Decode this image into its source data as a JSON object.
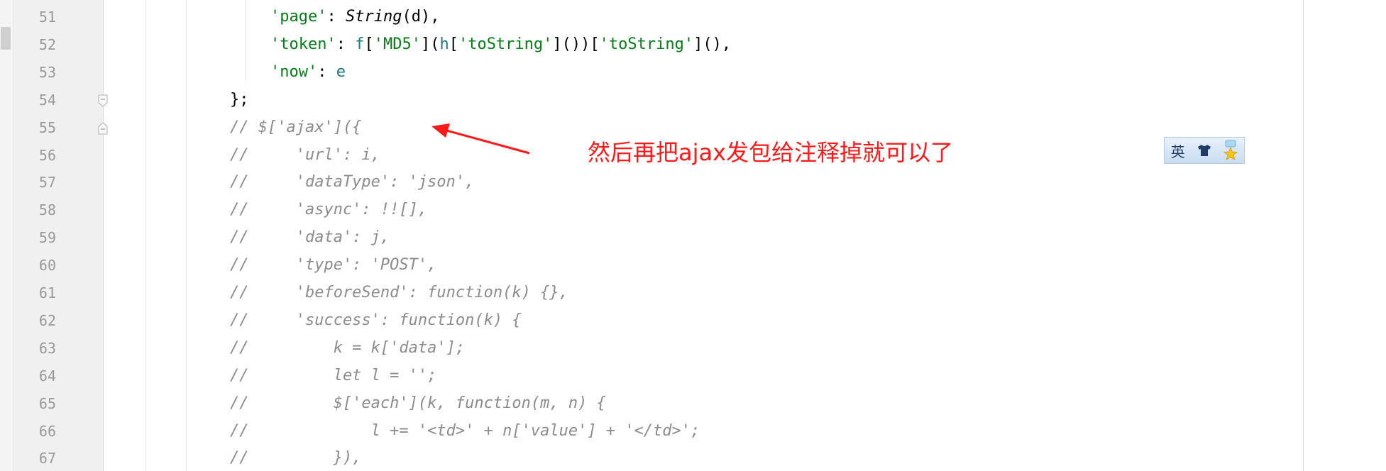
{
  "editor": {
    "lines": [
      {
        "number": "51",
        "pre": "    ",
        "k": "'page'",
        "mid": ": ",
        "fn": "String",
        "rest": "(d),",
        "kind": "page"
      },
      {
        "number": "52",
        "kind": "token",
        "k": "'token'",
        "sep": ": ",
        "f": "f",
        "o1": "[",
        "s1": "'MD5'",
        "o2": "](",
        "h": "h",
        "o3": "[",
        "s2": "'toString'",
        "o4": "]())[",
        "s3": "'toString'",
        "o5": "](),"
      },
      {
        "number": "53",
        "kind": "now",
        "k": "'now'",
        "sep": ": ",
        "e": "e"
      },
      {
        "number": "54",
        "kind": "plain",
        "text": "};"
      },
      {
        "number": "55",
        "kind": "comment",
        "text": "// $['ajax']({"
      },
      {
        "number": "56",
        "kind": "comment",
        "text": "//     'url': i,"
      },
      {
        "number": "57",
        "kind": "comment",
        "text": "//     'dataType': 'json',"
      },
      {
        "number": "58",
        "kind": "comment",
        "text": "//     'async': !![],"
      },
      {
        "number": "59",
        "kind": "comment",
        "text": "//     'data': j,"
      },
      {
        "number": "60",
        "kind": "comment",
        "text": "//     'type': 'POST',"
      },
      {
        "number": "61",
        "kind": "comment",
        "text": "//     'beforeSend': function(k) {},"
      },
      {
        "number": "62",
        "kind": "comment",
        "text": "//     'success': function(k) {"
      },
      {
        "number": "63",
        "kind": "comment",
        "text": "//         k = k['data'];"
      },
      {
        "number": "64",
        "kind": "comment",
        "text": "//         let l = '';"
      },
      {
        "number": "65",
        "kind": "comment",
        "text": "//         $['each'](k, function(m, n) {"
      },
      {
        "number": "66",
        "kind": "comment",
        "text": "//             l += '<td>' + n['value'] + '</td>';"
      },
      {
        "number": "67",
        "kind": "comment",
        "text": "//         }),"
      }
    ]
  },
  "annotation": {
    "text": "然后再把ajax发包给注释掉就可以了",
    "color": "#ff1a1a"
  },
  "ime": {
    "mode_label": "英",
    "skin_icon": "shirt-icon",
    "settings_icon": "star-icon"
  }
}
